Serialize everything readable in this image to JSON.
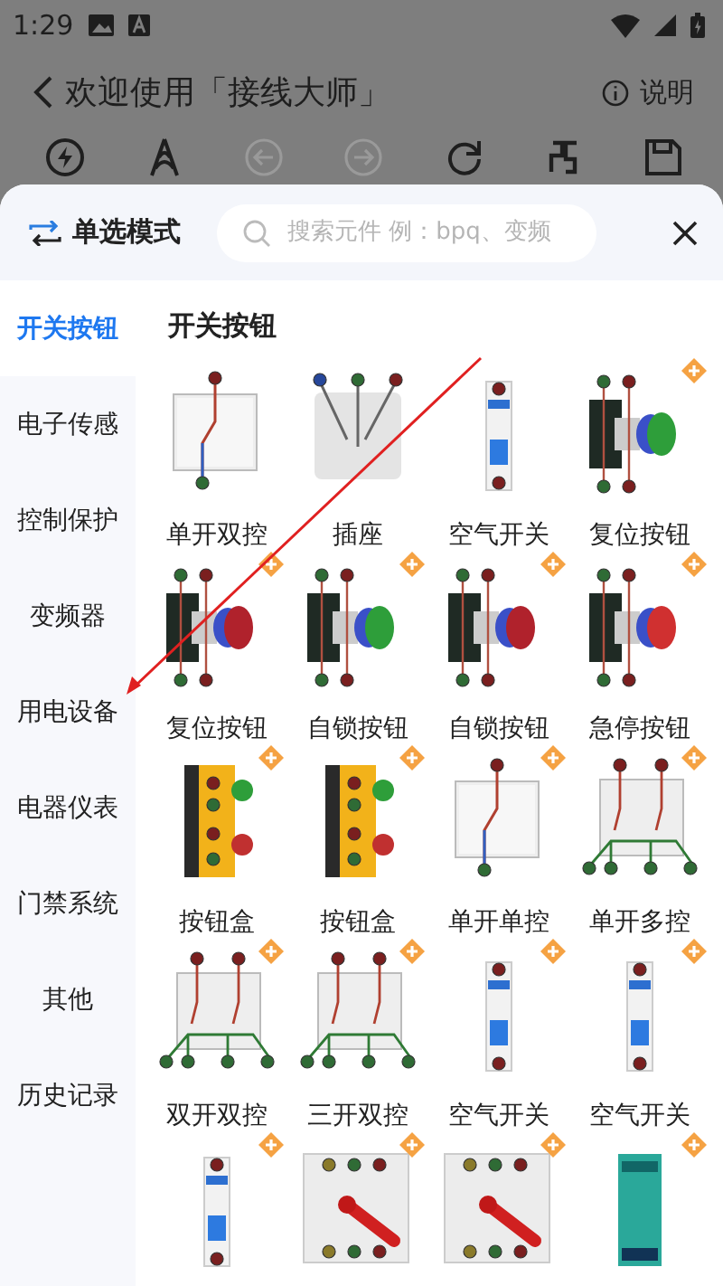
{
  "status_bar": {
    "time": "1:29"
  },
  "header": {
    "title": "欢迎使用「接线大师」",
    "help": "说明"
  },
  "toolbar": [
    {
      "kind": "power",
      "disabled": false
    },
    {
      "kind": "probe",
      "disabled": false
    },
    {
      "kind": "undo",
      "disabled": true
    },
    {
      "kind": "redo",
      "disabled": true
    },
    {
      "kind": "refresh",
      "disabled": false
    },
    {
      "kind": "wire",
      "disabled": false
    },
    {
      "kind": "save",
      "disabled": false
    }
  ],
  "sheet": {
    "mode": "单选模式",
    "search": {
      "placeholder": "搜索元件 例：bpq、变频"
    }
  },
  "sidebar": {
    "items": [
      {
        "label": "开关按钮",
        "selected": true
      },
      {
        "label": "电子传感",
        "selected": false
      },
      {
        "label": "控制保护",
        "selected": false
      },
      {
        "label": "变频器",
        "selected": false
      },
      {
        "label": "用电设备",
        "selected": false
      },
      {
        "label": "电器仪表",
        "selected": false
      },
      {
        "label": "门禁系统",
        "selected": false
      },
      {
        "label": "其他",
        "selected": false
      },
      {
        "label": "历史记录",
        "selected": false
      }
    ]
  },
  "section": {
    "title": "开关按钮"
  },
  "parts": [
    {
      "label": "单开双控",
      "kind": "switch",
      "premium": false
    },
    {
      "label": "插座",
      "kind": "socket",
      "premium": false
    },
    {
      "label": "空气开关",
      "kind": "breaker",
      "premium": false
    },
    {
      "label": "复位按钮",
      "kind": "button",
      "color": "#2e9e3a",
      "premium": true
    },
    {
      "label": "复位按钮",
      "kind": "button",
      "color": "#b0222c",
      "premium": true
    },
    {
      "label": "自锁按钮",
      "kind": "button",
      "color": "#2e9e3a",
      "premium": true
    },
    {
      "label": "自锁按钮",
      "kind": "button",
      "color": "#b0222c",
      "premium": true
    },
    {
      "label": "急停按钮",
      "kind": "estop",
      "premium": true
    },
    {
      "label": "按钮盒",
      "kind": "buttonbox",
      "premium": true
    },
    {
      "label": "按钮盒",
      "kind": "buttonbox",
      "premium": true
    },
    {
      "label": "单开单控",
      "kind": "switch",
      "premium": true
    },
    {
      "label": "单开多控",
      "kind": "multiswitch",
      "premium": true
    },
    {
      "label": "双开双控",
      "kind": "multiswitch",
      "premium": true
    },
    {
      "label": "三开双控",
      "kind": "multiswitch",
      "premium": true
    },
    {
      "label": "空气开关",
      "kind": "breaker",
      "premium": true
    },
    {
      "label": "空气开关",
      "kind": "breaker",
      "premium": true
    },
    {
      "kind": "breaker",
      "premium": true
    },
    {
      "kind": "isolator",
      "premium": true
    },
    {
      "kind": "isolator",
      "premium": true
    },
    {
      "kind": "psu",
      "premium": true
    }
  ]
}
